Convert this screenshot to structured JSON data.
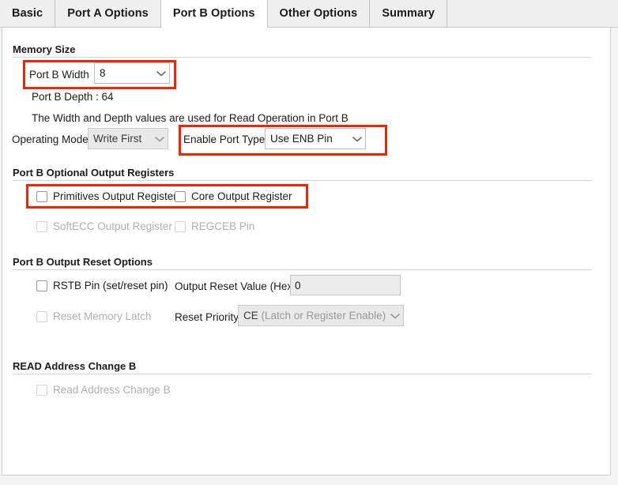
{
  "window": {
    "background": "#f4f4f4",
    "panel_background": "#ffffff",
    "annotation_color": "#f62200"
  },
  "tabs": [
    {
      "label": "Basic",
      "active": false
    },
    {
      "label": "Port A Options",
      "active": false
    },
    {
      "label": "Port B Options",
      "active": true
    },
    {
      "label": "Other Options",
      "active": false
    },
    {
      "label": "Summary",
      "active": false
    }
  ],
  "sections": {
    "memory_size": {
      "title": "Memory Size",
      "port_b_width_label": "Port B Width",
      "port_b_width_value": "8",
      "port_b_depth_text": "Port B Depth : 64",
      "note": "The Width and Depth values are used for Read Operation in Port B",
      "operating_mode_label": "Operating Mode",
      "operating_mode_value": "Write First",
      "enable_port_type_label": "Enable Port Type",
      "enable_port_type_value": "Use ENB Pin"
    },
    "optional_output_registers": {
      "title": "Port B Optional Output Registers",
      "checkboxes": [
        {
          "label": "Primitives Output Register",
          "checked": false,
          "enabled": true
        },
        {
          "label": "Core Output Register",
          "checked": false,
          "enabled": true
        },
        {
          "label": "SoftECC Output Register",
          "checked": false,
          "enabled": false
        },
        {
          "label": "REGCEB Pin",
          "checked": false,
          "enabled": false
        }
      ]
    },
    "output_reset_options": {
      "title": "Port B Output Reset Options",
      "rstb_pin_label": "RSTB Pin (set/reset pin)",
      "reset_memory_latch_label": "Reset Memory Latch",
      "output_reset_value_label": "Output Reset Value (Hex)",
      "output_reset_value": "0",
      "reset_priority_label": "Reset Priority",
      "reset_priority_value": "CE",
      "reset_priority_value_sub": " (Latch or Register Enable)"
    },
    "read_address_change": {
      "title": "READ Address Change B",
      "checkbox_label": "Read Address Change B"
    }
  },
  "icons": {
    "chevron_down": "chevron-down-icon"
  }
}
